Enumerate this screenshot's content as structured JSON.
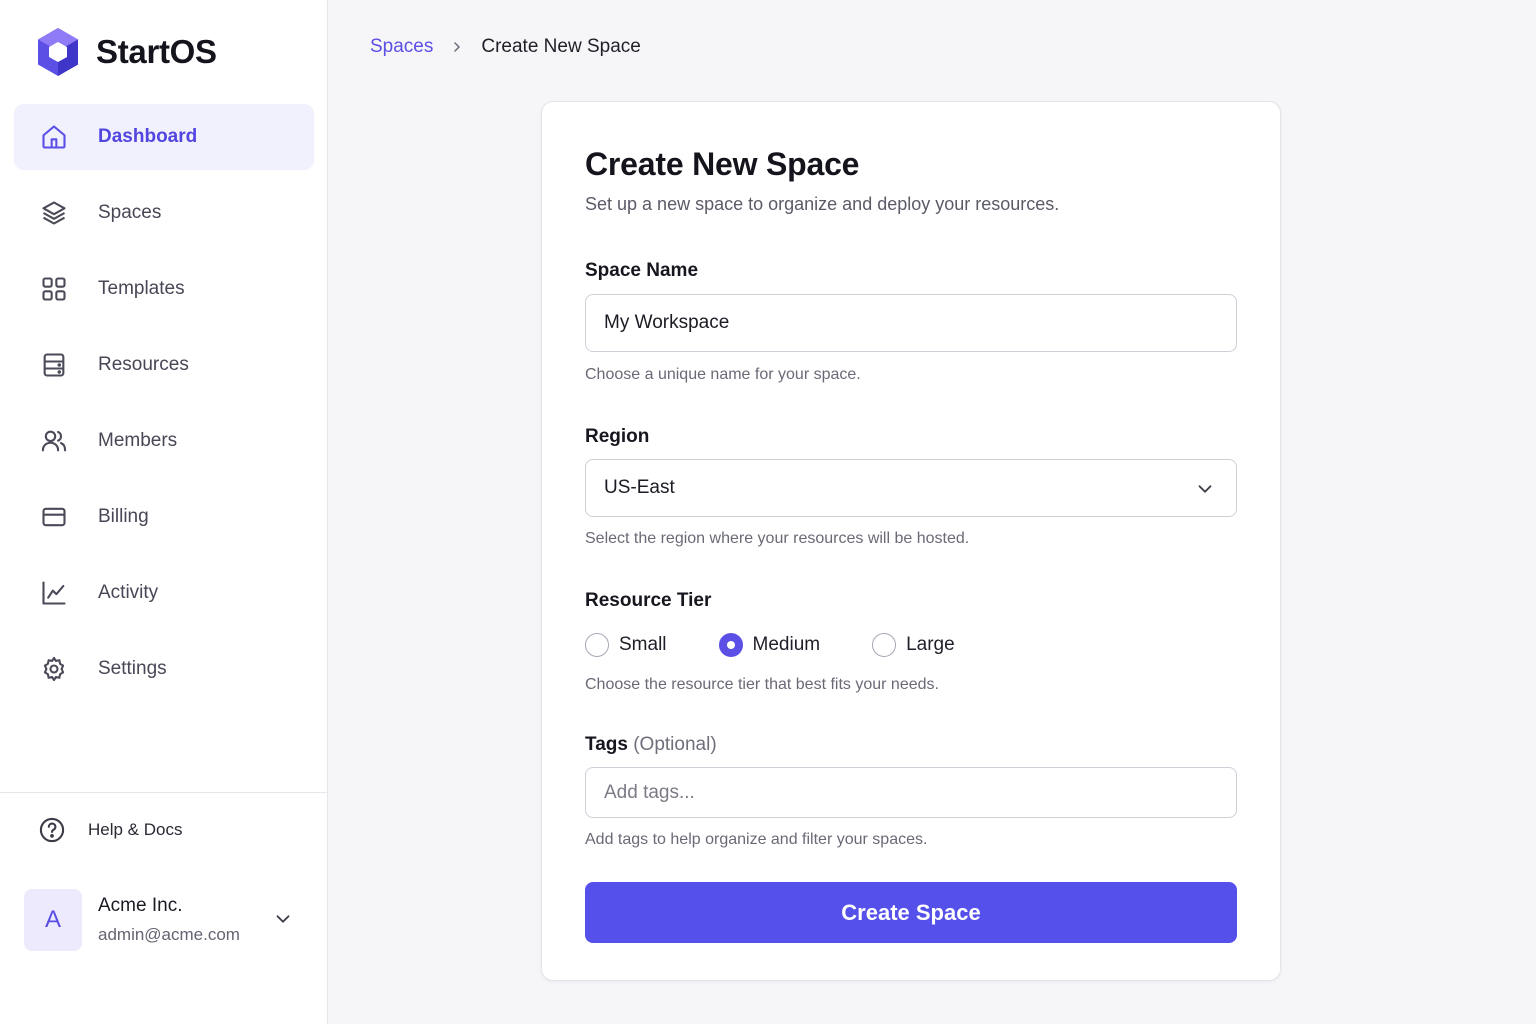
{
  "brand": {
    "name": "StartOS",
    "logo_icon": "hexagon-logo-icon"
  },
  "nav": [
    {
      "label": "Dashboard",
      "icon": "home-icon",
      "active": true
    },
    {
      "label": "Spaces",
      "icon": "layers-icon",
      "active": false
    },
    {
      "label": "Templates",
      "icon": "grid-icon",
      "active": false
    },
    {
      "label": "Resources",
      "icon": "server-icon",
      "active": false
    },
    {
      "label": "Members",
      "icon": "users-icon",
      "active": false
    },
    {
      "label": "Billing",
      "icon": "card-icon",
      "active": false
    },
    {
      "label": "Activity",
      "icon": "chart-icon",
      "active": false
    },
    {
      "label": "Settings",
      "icon": "gear-icon",
      "active": false
    }
  ],
  "help": {
    "label": "Help & Docs",
    "icon": "help-circle-icon"
  },
  "account": {
    "initial": "A",
    "name": "Acme Inc.",
    "email": "admin@acme.com"
  },
  "breadcrumb": {
    "parent": "Spaces",
    "current": "Create New Space"
  },
  "form": {
    "title": "Create New Space",
    "subtitle": "Set up a new space to organize and deploy your resources.",
    "space_name": {
      "label": "Space Name",
      "value": "My Workspace",
      "help": "Choose a unique name for your space."
    },
    "region": {
      "label": "Region",
      "value": "US-East",
      "help": "Select the region where your resources will be hosted."
    },
    "tier": {
      "label": "Resource Tier",
      "options": [
        "Small",
        "Medium",
        "Large"
      ],
      "selected": "Medium",
      "help": "Choose the resource tier that best fits your needs."
    },
    "tags": {
      "label": "Tags",
      "optional": "(Optional)",
      "placeholder": "Add tags...",
      "help": "Add tags to help organize and filter your spaces."
    },
    "submit_label": "Create Space"
  },
  "colors": {
    "accent": "#5b4fe6",
    "button": "#5550ea",
    "active_bg": "#f1f0fd"
  }
}
